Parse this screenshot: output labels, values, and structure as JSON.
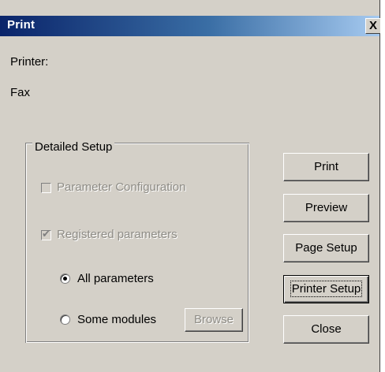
{
  "window": {
    "title": "Print",
    "close_glyph": "X"
  },
  "printer": {
    "label": "Printer:",
    "value": "Fax"
  },
  "detailed_setup": {
    "legend": "Detailed Setup",
    "parameter_configuration": {
      "label": "Parameter Configuration",
      "checked": false,
      "enabled": false
    },
    "registered_parameters": {
      "label": "Registered parameters",
      "checked": true,
      "enabled": false
    },
    "all_parameters": {
      "label": "All parameters",
      "selected": true
    },
    "some_modules": {
      "label": "Some modules",
      "selected": false
    },
    "browse_label": "Browse"
  },
  "buttons": {
    "print": "Print",
    "preview": "Preview",
    "page_setup": "Page Setup",
    "printer_setup": "Printer Setup",
    "close": "Close"
  }
}
